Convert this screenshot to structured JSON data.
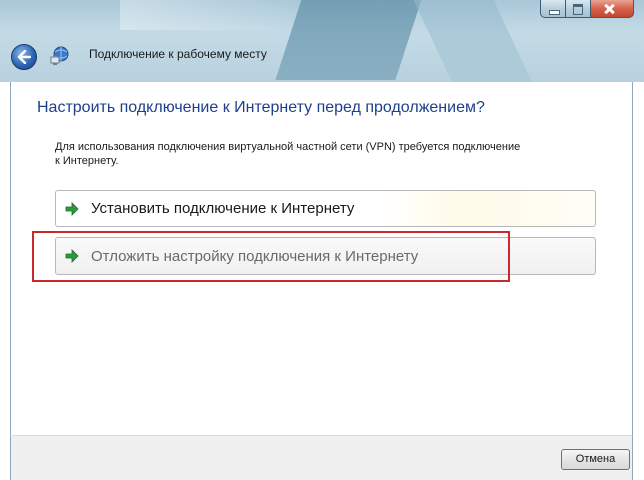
{
  "window": {
    "title": "Подключение к рабочему месту"
  },
  "main": {
    "heading": "Настроить подключение к Интернету перед продолжением?",
    "description": "Для использования подключения виртуальной частной сети (VPN) требуется подключение к Интернету.",
    "options": [
      {
        "label": "Установить подключение к Интернету",
        "icon": "green-arrow-icon"
      },
      {
        "label": "Отложить настройку подключения к Интернету",
        "icon": "green-arrow-icon"
      }
    ]
  },
  "footer": {
    "cancel_label": "Отмена"
  },
  "colors": {
    "heading": "#1e3f8c",
    "highlight": "#cc2a2a",
    "arrow": "#2e9a3c"
  }
}
